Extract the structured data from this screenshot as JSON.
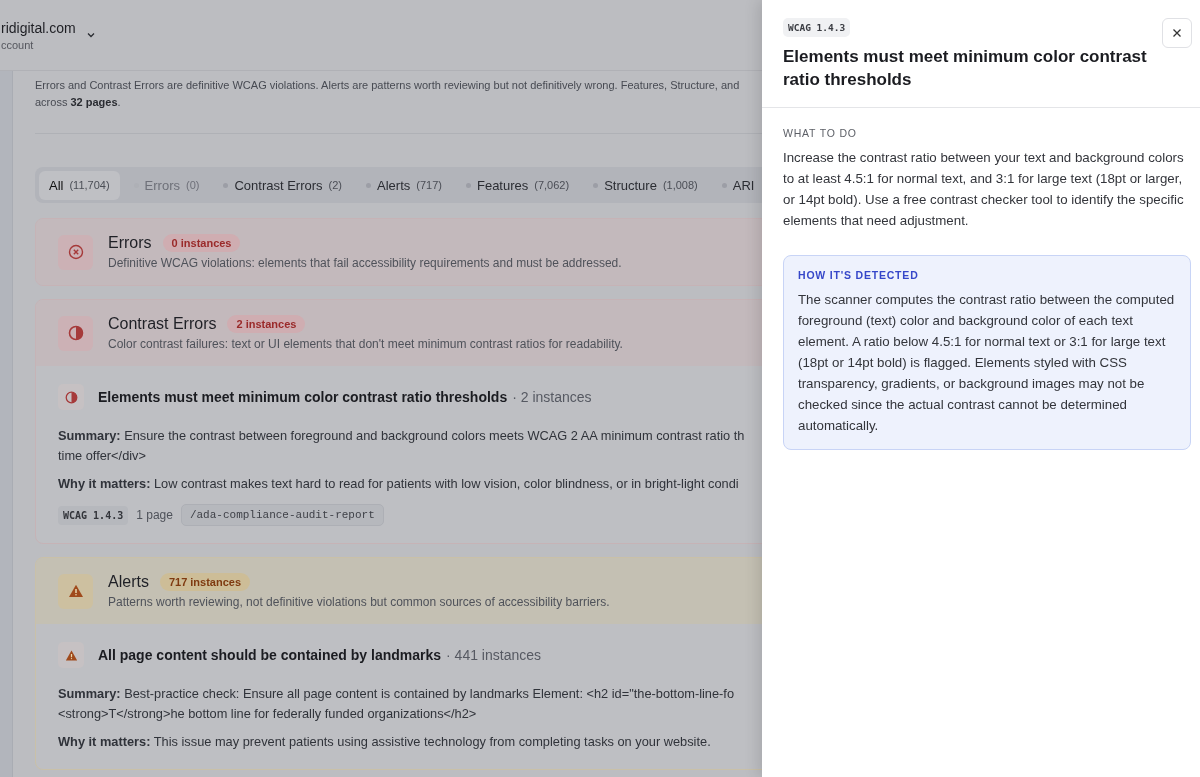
{
  "account": {
    "name": "ridigital.com",
    "subtitle": "ccount"
  },
  "intro": "Errors and Contrast Errors are definitive WCAG violations. Alerts are patterns worth reviewing but not definitively wrong. Features, Structure, and\nacross **32 pages**.",
  "tabs": [
    {
      "label": "All",
      "count": "(11,704)",
      "selected": true,
      "disabled": false
    },
    {
      "label": "Errors",
      "count": "(0)",
      "selected": false,
      "disabled": true
    },
    {
      "label": "Contrast Errors",
      "count": "(2)",
      "selected": false,
      "disabled": false
    },
    {
      "label": "Alerts",
      "count": "(717)",
      "selected": false,
      "disabled": false
    },
    {
      "label": "Features",
      "count": "(7,062)",
      "selected": false,
      "disabled": false
    },
    {
      "label": "Structure",
      "count": "(1,008)",
      "selected": false,
      "disabled": false
    },
    {
      "label": "ARI",
      "selected": false,
      "disabled": false
    }
  ],
  "sections": [
    {
      "kind": "error",
      "title": "Errors",
      "badge": "0 instances",
      "description": "Definitive WCAG violations: elements that fail accessibility requirements and must be addressed."
    },
    {
      "kind": "contrast",
      "title": "Contrast Errors",
      "badge": "2 instances",
      "description": "Color contrast failures: text or UI elements that don't meet minimum contrast ratios for readability.",
      "rules": [
        {
          "title": "Elements must meet minimum color contrast ratio thresholds",
          "count": "· 2 instances",
          "summary": "**Summary:** Ensure the contrast between foreground and background colors meets WCAG 2 AA minimum contrast ratio th\ntime offer</div>",
          "why": "**Why it matters:** Low contrast makes text hard to read for patients with low vision, color blindness, or in bright-light condi",
          "wcag": "WCAG 1.4.3",
          "pages": "1 page",
          "url": "/ada-compliance-audit-report"
        }
      ]
    },
    {
      "kind": "alert",
      "title": "Alerts",
      "badge": "717 instances",
      "description": "Patterns worth reviewing, not definitive violations but common sources of accessibility barriers.",
      "rules": [
        {
          "title": "All page content should be contained by landmarks",
          "count": "· 441 instances",
          "summary": "**Summary:** Best-practice check: Ensure all page content is contained by landmarks Element: <h2 id=\"the-bottom-line-fo\n<strong>T</strong>he bottom line for federally funded organizations</h2>",
          "why": "**Why it matters:** This issue may prevent patients using assistive technology from completing tasks on your website."
        }
      ]
    }
  ],
  "drawer": {
    "badge": "WCAG 1.4.3",
    "title": "Elements must meet minimum color contrast ratio thresholds",
    "what_to_do": {
      "heading": "WHAT TO DO",
      "text": "Increase the contrast ratio between your text and background colors to at least 4.5:1 for normal text, and 3:1 for large text (18pt or larger, or 14pt bold). Use a free contrast checker tool to identify the specific elements that need adjustment."
    },
    "detection": {
      "heading": "HOW IT'S DETECTED",
      "text": "The scanner computes the contrast ratio between the computed foreground (text) color and background color of each text element. A ratio below 4.5:1 for normal text or 3:1 for large text (18pt or 14pt bold) is flagged. Elements styled with CSS transparency, gradients, or background images may not be checked since the actual contrast cannot be determined automatically."
    }
  }
}
